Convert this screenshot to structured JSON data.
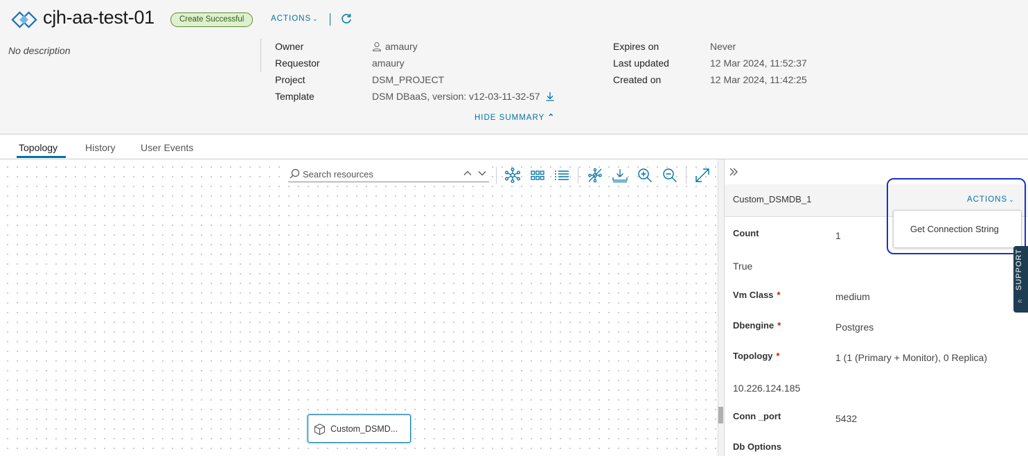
{
  "header": {
    "title": "cjh-aa-test-01",
    "status": "Create Successful",
    "actions_label": "ACTIONS",
    "description": "No description",
    "hide_summary_label": "HIDE SUMMARY"
  },
  "summary": {
    "owner_label": "Owner",
    "owner_value": "amaury",
    "requestor_label": "Requestor",
    "requestor_value": "amaury",
    "project_label": "Project",
    "project_value": "DSM_PROJECT",
    "template_label": "Template",
    "template_value": "DSM DBaaS, version: v12-03-11-32-57",
    "expires_label": "Expires on",
    "expires_value": "Never",
    "updated_label": "Last updated",
    "updated_value": "12 Mar 2024, 11:52:37",
    "created_label": "Created on",
    "created_value": "12 Mar 2024, 11:42:25"
  },
  "tabs": [
    {
      "label": "Topology",
      "active": true
    },
    {
      "label": "History",
      "active": false
    },
    {
      "label": "User Events",
      "active": false
    }
  ],
  "canvas": {
    "search_placeholder": "Search resources",
    "node_label": "Custom_DSMD...",
    "toolbar_icons": [
      "topology-view-icon",
      "grid-view-icon",
      "list-view-icon",
      "hide-connections-icon",
      "download-icon",
      "zoom-in-icon",
      "zoom-out-icon",
      "expand-icon"
    ]
  },
  "panel": {
    "title": "Custom_DSMDB_1",
    "actions_label": "ACTIONS",
    "menu_item": "Get Connection String",
    "props": {
      "count_label": "Count",
      "count_value": "1",
      "bool_value": "True",
      "vmclass_label": "Vm Class",
      "vmclass_value": "medium",
      "dbengine_label": "Dbengine",
      "dbengine_value": "Postgres",
      "topology_label": "Topology",
      "topology_value": "1 (1 (Primary + Monitor), 0 Replica)",
      "ip_value": "10.226.124.185",
      "port_label": "Conn _port",
      "port_value": "5432",
      "dboptions_label": "Db Options"
    },
    "required_mark": "*"
  },
  "support": {
    "label": "SUPPORT"
  },
  "colors": {
    "accent": "#0072a3",
    "success_bg": "#dff0d0",
    "success_border": "#5d8c2b",
    "highlight": "#1a2fc9",
    "required": "#c21d00"
  }
}
